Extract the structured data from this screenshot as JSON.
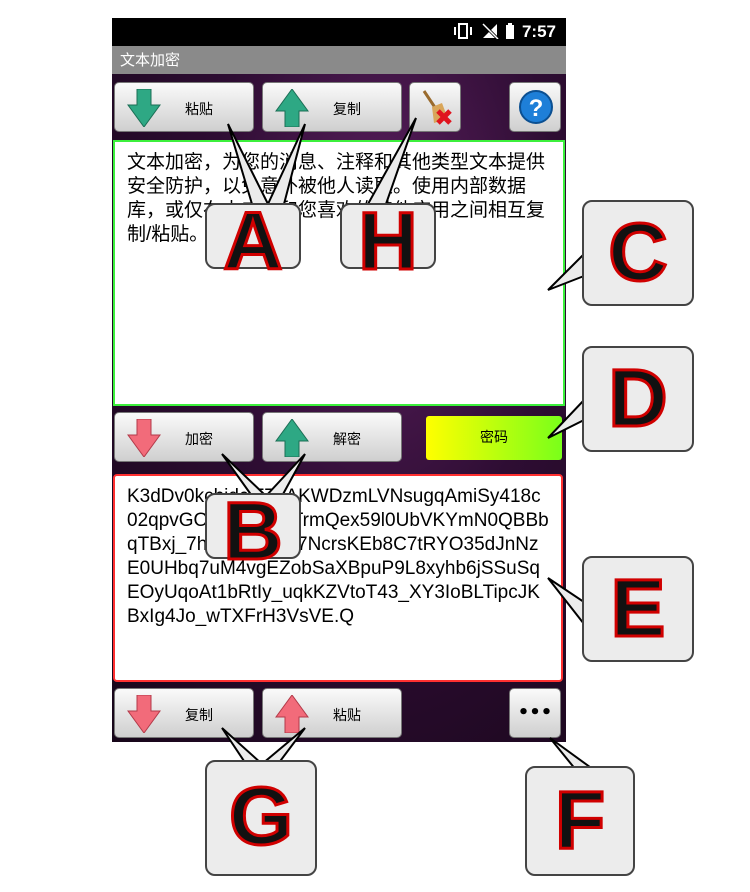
{
  "statusbar": {
    "time": "7:57"
  },
  "app": {
    "title": "文本加密"
  },
  "toolbar_top": {
    "paste_label": "粘贴",
    "copy_label": "复制"
  },
  "input": {
    "text": "文本加密，为您的消息、注释和其他类型文本提供安全防护，以免意外被他人读取。使用内部数据库，或仅在本应用和您喜欢的其他应用之间相互复制/粘贴。"
  },
  "toolbar_mid": {
    "encrypt_label": "加密",
    "decrypt_label": "解密",
    "password_label": "密码"
  },
  "output": {
    "text": "K3dDv0kchidciF7bAKWDzmLVNsugqAmiSy418c02qpvGO_gnMqiouTrmQex59l0UbVKYmN0QBBbqTBxj_7hmiFg6hmg7NcrsKEb8C7tRYO35dJnNzE0UHbq7uM4vgEZobSaXBpuP9L8xyhb6jSSuSqEOyUqoAt1bRtIy_uqkKZVtoT43_XY3IoBLTipcJKBxIg4Jo_wTXFrH3VsVE.Q"
  },
  "toolbar_bottom": {
    "copy_label": "复制",
    "paste_label": "粘贴",
    "more_label": "•••"
  },
  "callouts": {
    "a": "A",
    "b": "B",
    "c": "C",
    "d": "D",
    "e": "E",
    "f": "F",
    "g": "G",
    "h": "H"
  },
  "colors": {
    "accent_green": "#3cf03c",
    "accent_red": "#ff3030",
    "password_gradient": [
      "#ffff00",
      "#7aff1a"
    ]
  }
}
